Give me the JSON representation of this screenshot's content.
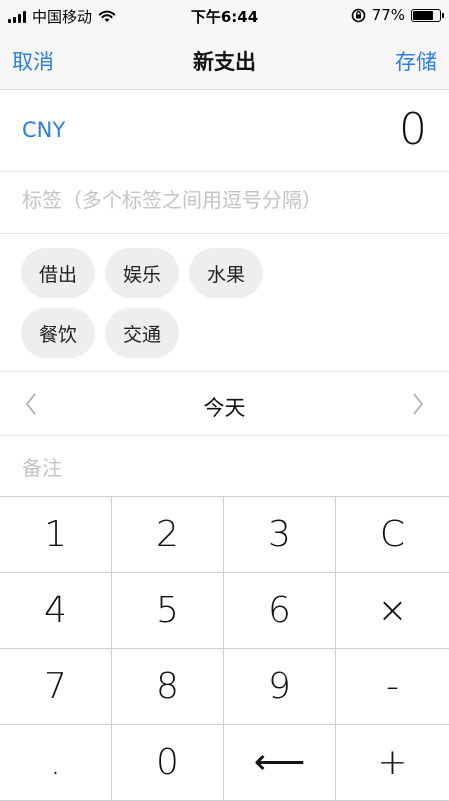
{
  "status_bar": {
    "carrier": "中国移动",
    "time": "下午6:44",
    "battery": "77%",
    "battery_level": 0.77
  },
  "nav": {
    "cancel_label": "取消",
    "title": "新支出",
    "save_label": "存储"
  },
  "amount": {
    "currency": "CNY",
    "value": "0"
  },
  "tags": {
    "placeholder": "标签（多个标签之间用逗号分隔）",
    "chips": [
      "借出",
      "娱乐",
      "水果",
      "餐饮",
      "交通"
    ]
  },
  "date": {
    "label": "今天"
  },
  "note": {
    "placeholder": "备注"
  },
  "keypad": {
    "keys": [
      "1",
      "2",
      "3",
      "C",
      "4",
      "5",
      "6",
      "×",
      "7",
      "8",
      "9",
      "-",
      ".",
      "0",
      "⟵",
      "+"
    ]
  },
  "colors": {
    "accent": "#2b7de9",
    "chip_bg": "#eeeef0",
    "placeholder": "#c4c4c6"
  }
}
